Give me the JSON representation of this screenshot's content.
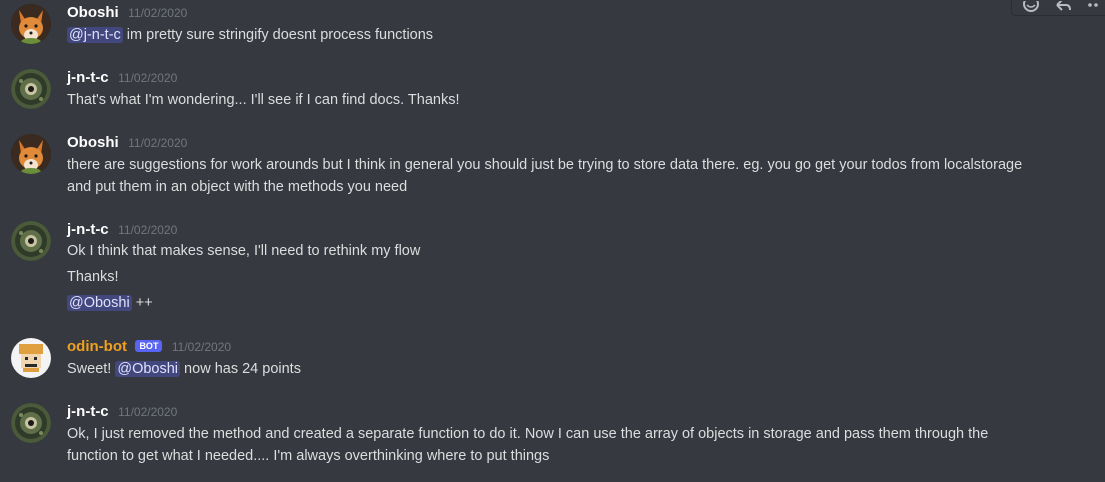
{
  "messages": [
    {
      "author": "Oboshi",
      "timestamp": "11/02/2020",
      "avatar": "fox-avatar",
      "lines": [
        {
          "mention": "@j-n-t-c",
          "text": " im pretty sure stringify doesnt process functions"
        }
      ]
    },
    {
      "author": "j-n-t-c",
      "timestamp": "11/02/2020",
      "avatar": "iguana-avatar",
      "lines": [
        {
          "text": "That's what I'm wondering... I'll see if I can find docs. Thanks!"
        }
      ]
    },
    {
      "author": "Oboshi",
      "timestamp": "11/02/2020",
      "avatar": "fox-avatar",
      "lines": [
        {
          "text": "there are suggestions for work arounds but I think in general you should just be trying to store data there. eg. you go get your todos from localstorage"
        },
        {
          "text": "and put them in an object with the methods you need"
        }
      ]
    },
    {
      "author": "j-n-t-c",
      "timestamp": "11/02/2020",
      "avatar": "iguana-avatar",
      "lines": [
        {
          "text": "Ok I think that makes sense, I'll need to rethink my flow"
        },
        {
          "text": "Thanks!"
        },
        {
          "mention": "@Oboshi",
          "text": " ++"
        }
      ]
    },
    {
      "author": "odin-bot",
      "bot_tag": "BOT",
      "timestamp": "11/02/2020",
      "avatar": "pixel-face-avatar",
      "lines": [
        {
          "prefix": "Sweet! ",
          "mention": "@Oboshi",
          "text": " now has 24 points"
        }
      ]
    },
    {
      "author": "j-n-t-c",
      "timestamp": "11/02/2020",
      "avatar": "iguana-avatar",
      "lines": [
        {
          "text": "Ok, I just removed the method and created a separate function to do it. Now I can use the array of objects in storage and pass them through the"
        },
        {
          "text": "function to get what I needed.... I'm always overthinking where to put things"
        }
      ]
    }
  ],
  "colors": {
    "background": "#36393f",
    "username": "#ffffff",
    "bot_username": "#f0a020",
    "bot_tag": "#5865f2",
    "timestamp": "#72767d",
    "mention_bg": "#4a5181"
  },
  "toolbar": {
    "icons": [
      "add-reaction-icon",
      "reply-icon",
      "more-icon"
    ]
  }
}
